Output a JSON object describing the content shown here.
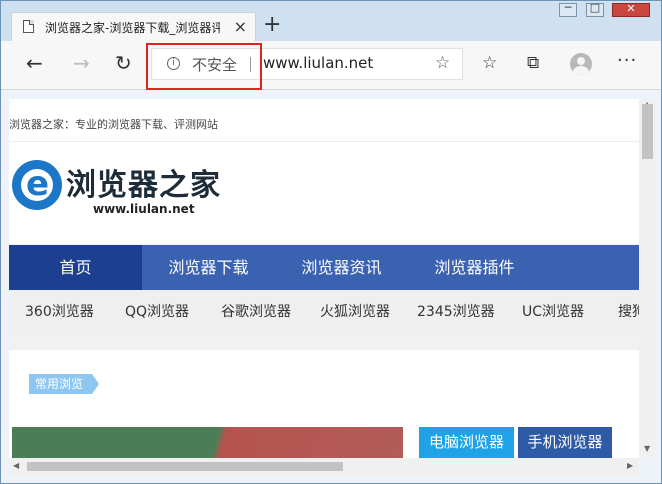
{
  "tab": {
    "title": "浏览器之家-浏览器下载_浏览器评测网站",
    "close_glyph": "×",
    "new_tab_glyph": "+"
  },
  "window_controls": {
    "minimize": "─",
    "maximize": "□",
    "close": "✕"
  },
  "toolbar": {
    "back_glyph": "←",
    "forward_glyph": "→",
    "reload_glyph": "↻",
    "info_glyph": "i",
    "insecure_label": "不安全",
    "url": "www.liulan.net",
    "star_glyph": "☆",
    "favorites_glyph": "☆",
    "collections_glyph": "⧉",
    "menu_glyph": "···"
  },
  "page": {
    "top_strip": "浏览器之家：专业的浏览器下载、评测网站",
    "logo_text": "浏览器之家",
    "logo_url": "www.liulan.net",
    "nav": [
      "首页",
      "浏览器下载",
      "浏览器资讯",
      "浏览器插件"
    ],
    "subnav": [
      "360浏览器",
      "QQ浏览器",
      "谷歌浏览器",
      "火狐浏览器",
      "2345浏览器",
      "UC浏览器",
      "搜狗"
    ],
    "tag": "常用浏览",
    "category_1": "电脑浏览器",
    "category_2": "手机浏览器"
  },
  "scroll": {
    "up": "▲",
    "down": "▼",
    "left": "◀",
    "right": "▶"
  },
  "icons": [
    "page-icon",
    "info-icon",
    "star-icon",
    "favorites-icon",
    "collections-icon",
    "avatar-icon",
    "logo-icon"
  ],
  "colors": {
    "nav_bg": "#3b62b0",
    "nav_active": "#1c3f8f",
    "highlight_box": "#e0231e",
    "category_1": "#20a3e6",
    "category_2": "#2f5aa6"
  }
}
